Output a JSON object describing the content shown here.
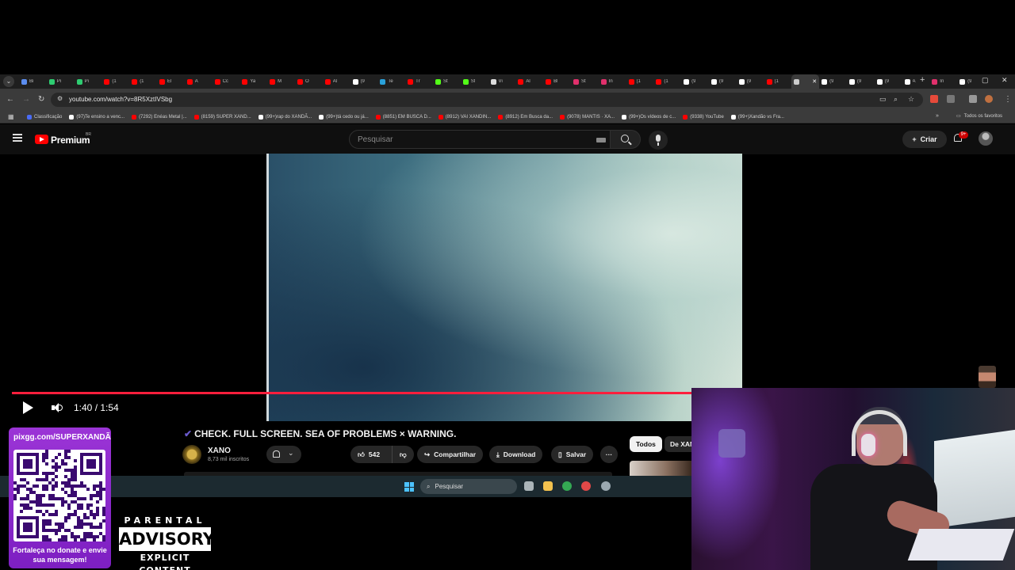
{
  "browser": {
    "tabs": [
      {
        "label": "Bi",
        "color": "#5b8def"
      },
      {
        "label": "Pi",
        "color": "#2ecc71"
      },
      {
        "label": "Pi",
        "color": "#2ecc71"
      },
      {
        "label": "(1",
        "color": "#ff0000"
      },
      {
        "label": "(1",
        "color": "#ff0000"
      },
      {
        "label": "El",
        "color": "#ff0000"
      },
      {
        "label": "A",
        "color": "#ff0000"
      },
      {
        "label": "Cc",
        "color": "#ff0000"
      },
      {
        "label": "Ya",
        "color": "#ff0000"
      },
      {
        "label": "M",
        "color": "#ff0000"
      },
      {
        "label": "O",
        "color": "#ff0000"
      },
      {
        "label": "Al",
        "color": "#ff0000"
      },
      {
        "label": "(9",
        "color": "#ffffff"
      },
      {
        "label": "Te",
        "color": "#2aa1da"
      },
      {
        "label": "Tr",
        "color": "#ff0000"
      },
      {
        "label": "St",
        "color": "#53fc18"
      },
      {
        "label": "St",
        "color": "#53fc18"
      },
      {
        "label": "Vi",
        "color": "#dddddd"
      },
      {
        "label": "Al",
        "color": "#ff0000"
      },
      {
        "label": "Bl",
        "color": "#ff0000"
      },
      {
        "label": "St",
        "color": "#e1306c"
      },
      {
        "label": "In",
        "color": "#e1306c"
      },
      {
        "label": "(1",
        "color": "#ff0000"
      },
      {
        "label": "(1",
        "color": "#ff0000"
      },
      {
        "label": "(9",
        "color": "#ffffff"
      },
      {
        "label": "(9",
        "color": "#ffffff"
      },
      {
        "label": "(9",
        "color": "#ffffff"
      },
      {
        "label": "(1",
        "color": "#ff0000"
      },
      {
        "label": "",
        "color": "#cccccc",
        "active": true
      },
      {
        "label": "(9",
        "color": "#ffffff"
      },
      {
        "label": "(9",
        "color": "#ffffff"
      },
      {
        "label": "(9",
        "color": "#ffffff"
      },
      {
        "label": "A",
        "color": "#ffffff"
      },
      {
        "label": "In",
        "color": "#e1306c"
      },
      {
        "label": "(9",
        "color": "#ffffff"
      }
    ],
    "new_tab": "+",
    "window_controls": {
      "minimize": "–",
      "maximize": "▢",
      "close": "✕"
    },
    "url": "youtube.com/watch?v=8R5XztIVSbg",
    "bookmarks": [
      {
        "label": "Classificação",
        "color": "#4a6cf7"
      },
      {
        "label": "(97)Te ensino a venc...",
        "color": "#ffffff"
      },
      {
        "label": "(7292) Enéas Metal |...",
        "color": "#ff0000"
      },
      {
        "label": "(8159) SUPER XAND...",
        "color": "#ff0000"
      },
      {
        "label": "(99+)rap do XANDÃ...",
        "color": "#ffffff"
      },
      {
        "label": "(99+)tá cedo ou já...",
        "color": "#ffffff"
      },
      {
        "label": "(8851) EM BUSCA D...",
        "color": "#ff0000"
      },
      {
        "label": "(8912) VAI XANDIN...",
        "color": "#ff0000"
      },
      {
        "label": "(8912) Em Busca da...",
        "color": "#ff0000"
      },
      {
        "label": "(9078) MANTIS · XA...",
        "color": "#ff0000"
      },
      {
        "label": "(99+)Os vídeos de c...",
        "color": "#ffffff"
      },
      {
        "label": "(9338) YouTube",
        "color": "#ff0000"
      },
      {
        "label": "(99+)Xandão vs Fra...",
        "color": "#ffffff"
      }
    ],
    "bookmarks_more": "»",
    "all_bookmarks": "Todos os favoritos"
  },
  "youtube": {
    "logo_text": "Premium",
    "region": "BR",
    "search_placeholder": "Pesquisar",
    "create_label": "Criar",
    "notification_count": "9+"
  },
  "player": {
    "current_time": "1:40",
    "duration": "1:54",
    "time_display": "1:40 / 1:54",
    "progress_fraction": 0.877
  },
  "video": {
    "title": "CHECK. FULL SCREEN. SEA OF PROBLEMS × WARNING.",
    "channel_name": "XANO",
    "subscribers": "8,73 mil inscritos",
    "likes": "542",
    "share_label": "Compartilhar",
    "download_label": "Download",
    "save_label": "Salvar",
    "more_label": "···",
    "chip_all": "Todos",
    "chip_channel": "De XANO"
  },
  "taskbar": {
    "search_placeholder": "Pesquisar",
    "apps": [
      {
        "name": "task-view",
        "color": "#aab4b8"
      },
      {
        "name": "file-explorer",
        "color": "#f2c14e"
      },
      {
        "name": "chrome",
        "color": "#34a853"
      },
      {
        "name": "app-red",
        "color": "#e04848"
      },
      {
        "name": "settings",
        "color": "#9aa8b0"
      }
    ]
  },
  "overlay": {
    "donate_url": "pixgg.com/SUPERXANDÃO",
    "donate_message": "Fortaleça no donate e envie sua mensagem!",
    "parental_top": "PARENTAL",
    "parental_middle": "ADVISORY",
    "parental_bottom": "EXPLICIT CONTENT"
  },
  "colors": {
    "youtube_red": "#ff0000",
    "progress_red": "#ff1e3c",
    "donate_purple": "#8a2bd0"
  }
}
